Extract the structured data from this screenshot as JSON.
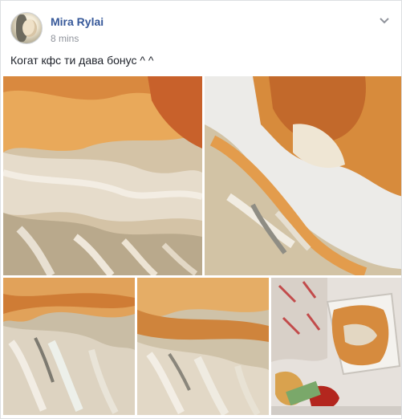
{
  "post": {
    "author": "Mira Rylai",
    "time": "8 mins",
    "caption": "Когат кфс ти дава бонус ^ ^"
  },
  "icons": {
    "menu": "chevron-down-icon"
  },
  "colors": {
    "author_link": "#365899",
    "meta_text": "#90949c",
    "body_text": "#1d2129"
  }
}
